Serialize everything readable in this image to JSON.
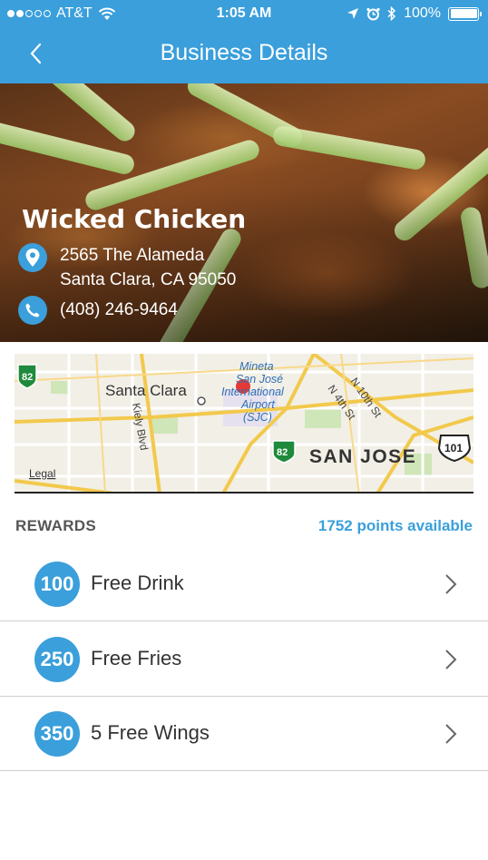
{
  "status_bar": {
    "carrier": "AT&T",
    "time": "1:05 AM",
    "battery": "100%"
  },
  "nav": {
    "title": "Business Details"
  },
  "business": {
    "name": "Wicked Chicken",
    "address_line1": "2565 The Alameda",
    "address_line2": "Santa Clara, CA 95050",
    "phone": "(408) 246-9464"
  },
  "map": {
    "labels": {
      "santa_clara": "Santa Clara",
      "san_jose": "SAN JOSE",
      "airport1": "Mineta",
      "airport2": "San José",
      "airport3": "International",
      "airport4": "Airport",
      "airport5": "(SJC)",
      "kiely": "Kiely Blvd",
      "n10th": "N 10th St",
      "n4th": "N 4th St",
      "hwy82a": "82",
      "hwy82b": "82",
      "hwy101": "101",
      "legal": "Legal"
    }
  },
  "rewards": {
    "label": "REWARDS",
    "points": "1752 points available",
    "items": [
      {
        "points": "100",
        "name": "Free Drink"
      },
      {
        "points": "250",
        "name": "Free Fries"
      },
      {
        "points": "350",
        "name": "5 Free Wings"
      }
    ]
  },
  "colors": {
    "accent": "#3a9fdb"
  }
}
